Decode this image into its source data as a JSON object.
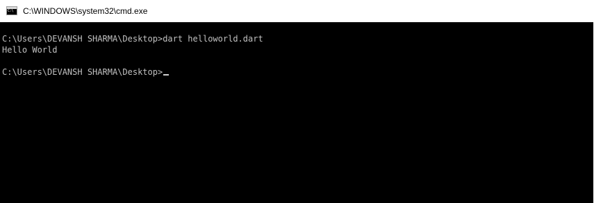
{
  "window": {
    "title": "C:\\WINDOWS\\system32\\cmd.exe",
    "icon": "cmd-icon",
    "icon_text": "C:\\"
  },
  "terminal": {
    "lines": [
      {
        "prompt": "C:\\Users\\DEVANSH SHARMA\\Desktop>",
        "command": "dart helloworld.dart"
      },
      {
        "output": "Hello World"
      },
      {
        "prompt": "C:\\Users\\DEVANSH SHARMA\\Desktop>",
        "command": ""
      }
    ],
    "background": "#000000",
    "foreground": "#c0c0c0"
  }
}
